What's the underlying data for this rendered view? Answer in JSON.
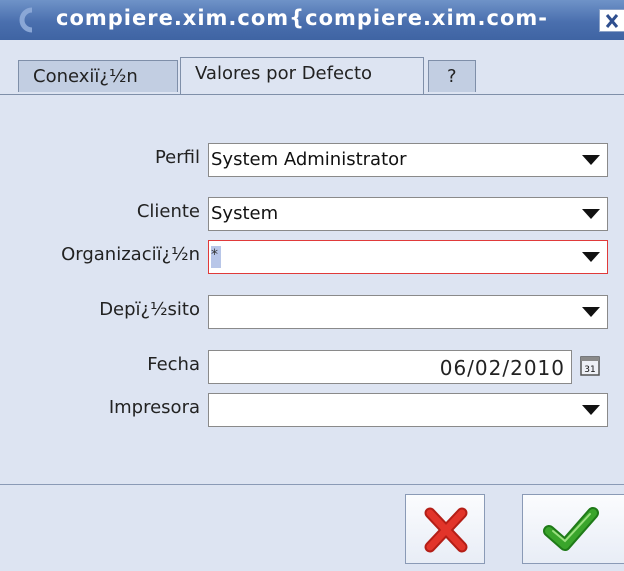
{
  "window": {
    "title": "compiere.xim.com{compiere.xim.com-"
  },
  "tabs": [
    {
      "label": "Conexiï¿½n"
    },
    {
      "label": "Valores por Defecto"
    },
    {
      "label": "?"
    }
  ],
  "form": {
    "perfil": {
      "label": "Perfil",
      "value": "System Administrator"
    },
    "cliente": {
      "label": "Cliente",
      "value": "System"
    },
    "organizacion": {
      "label": "Organizaciï¿½n",
      "value": "*"
    },
    "deposito": {
      "label": "Depï¿½sito",
      "value": ""
    },
    "fecha": {
      "label": "Fecha",
      "value": "06/02/2010",
      "calendar_icon_text": "31"
    },
    "impresora": {
      "label": "Impresora",
      "value": ""
    }
  },
  "colors": {
    "title_bar": "#4a6fae",
    "background": "#dde4f2",
    "error_border": "#e03a3a",
    "cancel_red": "#e2342a",
    "ok_green": "#3aa52b"
  },
  "icons": {
    "app_logo": "compiere-logo-icon",
    "close": "close-icon",
    "dropdown": "triangle-down-icon",
    "calendar": "calendar-icon",
    "cancel": "red-x-icon",
    "ok": "green-check-icon"
  }
}
